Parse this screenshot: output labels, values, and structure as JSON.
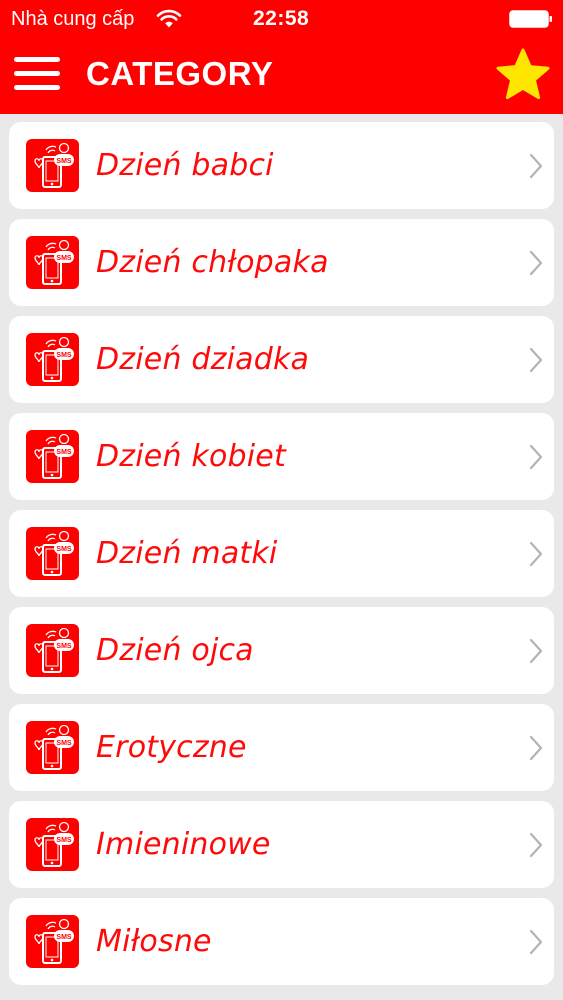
{
  "status_bar": {
    "carrier": "Nhà cung cấp",
    "time": "22:58"
  },
  "nav": {
    "title": "CATEGORY",
    "menu_icon": "hamburger-menu-icon",
    "favorite_icon": "star-icon"
  },
  "colors": {
    "header_bg": "#ff0000",
    "item_text": "#ff0a0a",
    "star": "#ffe600",
    "list_bg": "#e9e9e9",
    "chevron": "#b3b3b3"
  },
  "categories": [
    {
      "label": "Dzień babci"
    },
    {
      "label": "Dzień chłopaka"
    },
    {
      "label": "Dzień dziadka"
    },
    {
      "label": "Dzień kobiet"
    },
    {
      "label": "Dzień matki"
    },
    {
      "label": "Dzień ojca"
    },
    {
      "label": "Erotyczne"
    },
    {
      "label": "Imieninowe"
    },
    {
      "label": "Miłosne"
    }
  ]
}
